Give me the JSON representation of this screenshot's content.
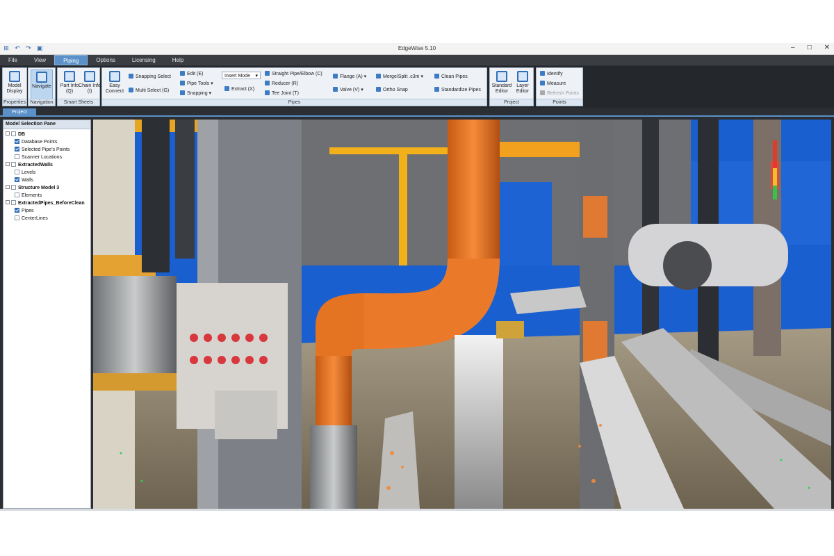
{
  "window": {
    "title": "EdgeWise 5.10",
    "controls": [
      "minimize-icon",
      "maximize-icon",
      "close-icon"
    ]
  },
  "menu": {
    "tabs": [
      "File",
      "View",
      "Piping",
      "Options",
      "Licensing",
      "Help"
    ],
    "active": "Piping"
  },
  "ribbon": {
    "properties": {
      "label": "Properties",
      "model_display": "Model Display"
    },
    "navigation": {
      "label": "Navigation",
      "navigate": "Navigate"
    },
    "smart_sheets": {
      "label": "Smart Sheets",
      "part_info": "Part Info (Q)",
      "chain_info": "Chain Info (I)"
    },
    "pipes": {
      "label": "Pipes",
      "easy_connect": "Easy Connect",
      "snapping_select": "Snapping Select",
      "multi_select": "Multi Select (G)",
      "edit": "Edit (E)",
      "pipe_tools": "Pipe Tools",
      "snapping": "Snapping",
      "insert_mode": "Insert Mode",
      "extract": "Extract (X)",
      "straight_pipe": "Straight Pipe/Elbow (C)",
      "reducer": "Reducer (R)",
      "tee_joint": "Tee Joint (T)",
      "flange": "Flange (A)",
      "valve": "Valve (V)",
      "merge_split": "Merge/Split .c3m",
      "ortho_snap": "Ortho Snap",
      "clean_pipes": "Clean Pipes",
      "standardize_pipes": "Standardize Pipes"
    },
    "project": {
      "label": "Project",
      "standard_editor": "Standard Editor",
      "layer_editor": "Layer Editor"
    },
    "points": {
      "label": "Points",
      "identify": "Identify",
      "measure": "Measure",
      "refresh_points": "Refresh Points"
    }
  },
  "document_tab": "Project",
  "model_selection_pane": {
    "title": "Model Selection Pane",
    "tree": [
      {
        "label": "DB",
        "level": 0,
        "checked": null
      },
      {
        "label": "Database Points",
        "level": 1,
        "checked": true
      },
      {
        "label": "Selected Pipe's Points",
        "level": 1,
        "checked": true
      },
      {
        "label": "Scanner Locations",
        "level": 1,
        "checked": false
      },
      {
        "label": "ExtractedWalls",
        "level": 0,
        "checked": null
      },
      {
        "label": "Levels",
        "level": 1,
        "checked": false
      },
      {
        "label": "Walls",
        "level": 1,
        "checked": true
      },
      {
        "label": "Structure Model 3",
        "level": 0,
        "checked": null
      },
      {
        "label": "Elements",
        "level": 1,
        "checked": false
      },
      {
        "label": "ExtractedPipes_BeforeClean",
        "level": 0,
        "checked": null
      },
      {
        "label": "Pipes",
        "level": 1,
        "checked": true
      },
      {
        "label": "CenterLines",
        "level": 1,
        "checked": false
      }
    ]
  },
  "colors": {
    "accent": "#5b91c8",
    "pipe_orange": "#f07a26",
    "sky_blue": "#1a5fd0",
    "yellow_rail": "#f2b01a"
  }
}
